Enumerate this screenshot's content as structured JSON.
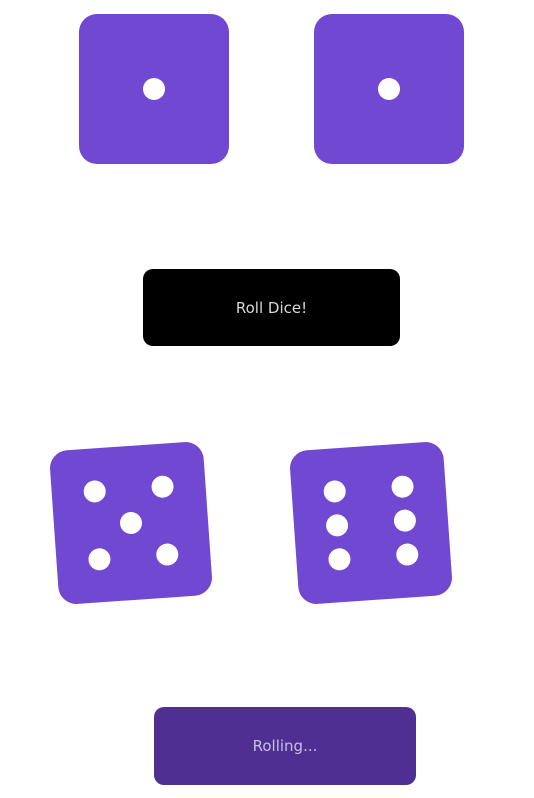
{
  "colors": {
    "die_fill": "#7048d2",
    "pip": "#ffffff",
    "roll_button_bg": "#000000",
    "rolling_button_bg": "#4f2f91"
  },
  "top_dice": {
    "left_value": 1,
    "right_value": 1
  },
  "roll_button": {
    "label": "Roll Dice!"
  },
  "bottom_dice": {
    "left_value": 5,
    "right_value": 6
  },
  "rolling_button": {
    "label": "Rolling..."
  }
}
